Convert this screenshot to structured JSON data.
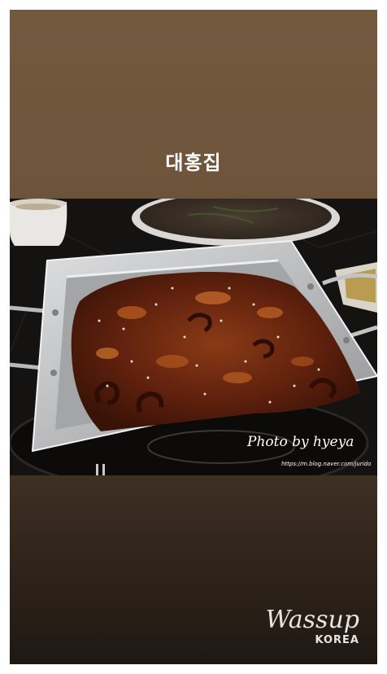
{
  "story": {
    "title": "대홍집"
  },
  "photo": {
    "credit": "Photo by hyeya",
    "credit_url": "https://m.blog.naver.com/jurido"
  },
  "watermark": {
    "brand": "Wassup",
    "sub": "KOREA"
  },
  "colors": {
    "background_top": "#73593e",
    "background_bottom": "#1f1812",
    "pan": "#c9cacb",
    "food_sauce": "#6a2510"
  }
}
